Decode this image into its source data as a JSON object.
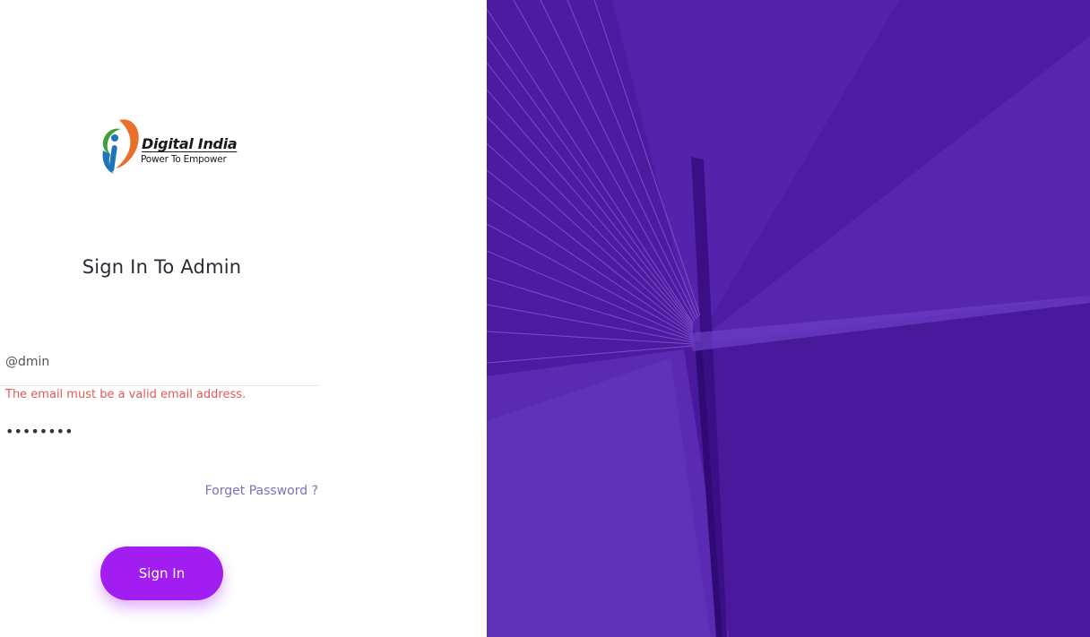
{
  "brand": {
    "title": "Digital India",
    "tagline": "Power To Empower",
    "colors": {
      "orange": "#e8702a",
      "blue": "#1e73b9",
      "green": "#3f9f3a"
    }
  },
  "login": {
    "heading": "Sign In To Admin",
    "email": {
      "value": "@dmin",
      "placeholder": ""
    },
    "email_error": "The email must be a valid email address.",
    "password": {
      "value": "12345678",
      "placeholder": ""
    },
    "forgot_label": "Forget Password ?",
    "signin_label": "Sign In"
  },
  "theme": {
    "accent": "#a11df0",
    "error": "#e05a5a",
    "link": "#7a72b8",
    "hero_background": "#4f1ca6"
  },
  "hero": {
    "icon": "bridge-architecture-image"
  }
}
